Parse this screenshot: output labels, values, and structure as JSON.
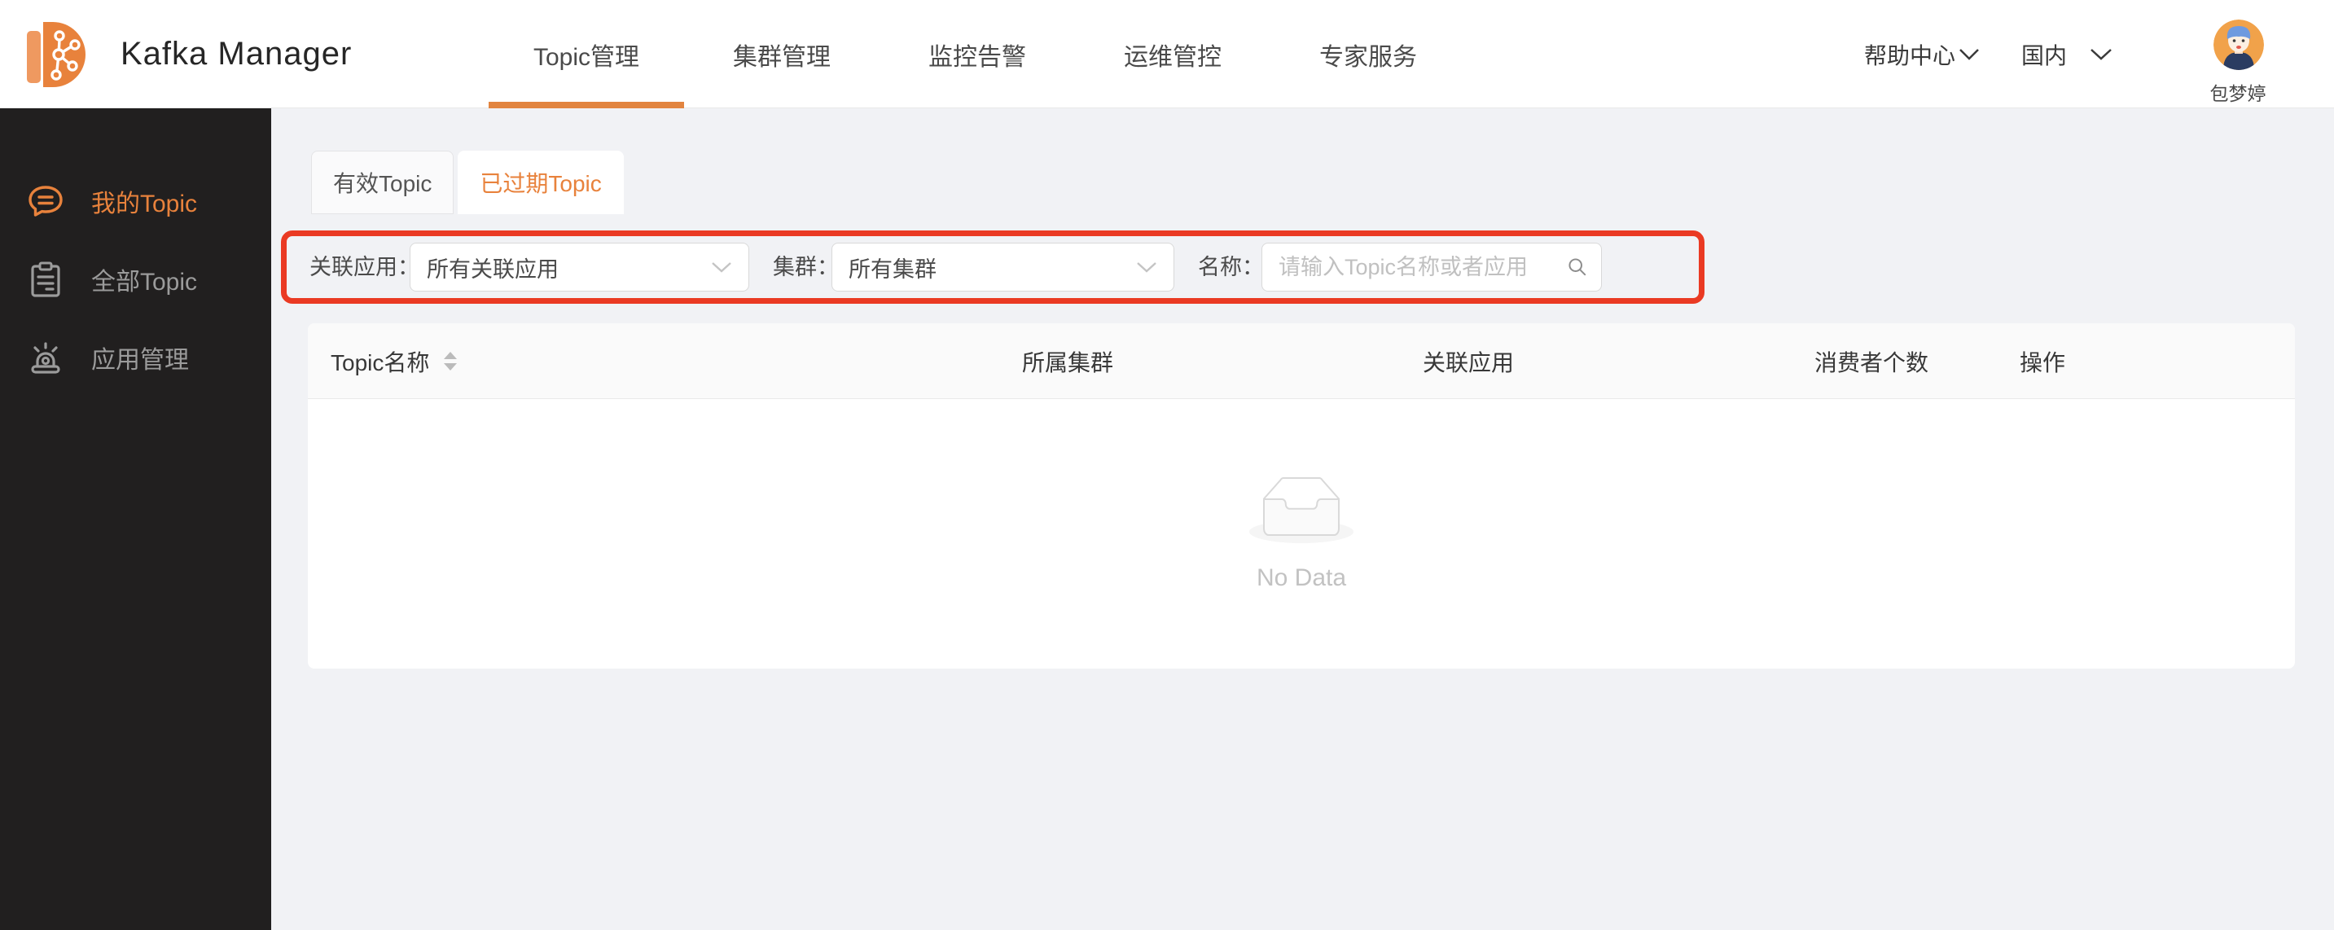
{
  "app": {
    "title": "Kafka Manager"
  },
  "header": {
    "nav_items": [
      {
        "label": "Topic管理",
        "active": true
      },
      {
        "label": "集群管理",
        "active": false
      },
      {
        "label": "监控告警",
        "active": false
      },
      {
        "label": "运维管控",
        "active": false
      },
      {
        "label": "专家服务",
        "active": false
      }
    ],
    "help_center": "帮助中心",
    "region": "国内",
    "user_name": "包梦婷"
  },
  "sidebar": {
    "items": [
      {
        "label": "我的Topic",
        "icon": "chat-bubble-icon",
        "active": true
      },
      {
        "label": "全部Topic",
        "icon": "clipboard-icon",
        "active": false
      },
      {
        "label": "应用管理",
        "icon": "alarm-lamp-icon",
        "active": false
      }
    ]
  },
  "main": {
    "tabs": [
      {
        "label": "有效Topic",
        "active": false
      },
      {
        "label": "已过期Topic",
        "active": true
      }
    ],
    "filters": {
      "app_label": "关联应用：",
      "app_value": "所有关联应用",
      "cluster_label": "集群：",
      "cluster_value": "所有集群",
      "name_label": "名称：",
      "name_placeholder": "请输入Topic名称或者应用",
      "name_value": ""
    },
    "table": {
      "columns": [
        "Topic名称",
        "所属集群",
        "关联应用",
        "消费者个数",
        "操作"
      ],
      "rows": [],
      "empty_text": "No Data"
    }
  },
  "colors": {
    "accent_orange": "#E8823C",
    "nav_underline_orange": "#E2843F",
    "annotation_red": "#EA3A23",
    "sidebar_bg": "#211F1F",
    "page_bg": "#F1F2F5",
    "card_bg": "#FFFFFF",
    "table_header_bg": "#FAFAFA",
    "placeholder_gray": "#C0C0C0"
  }
}
